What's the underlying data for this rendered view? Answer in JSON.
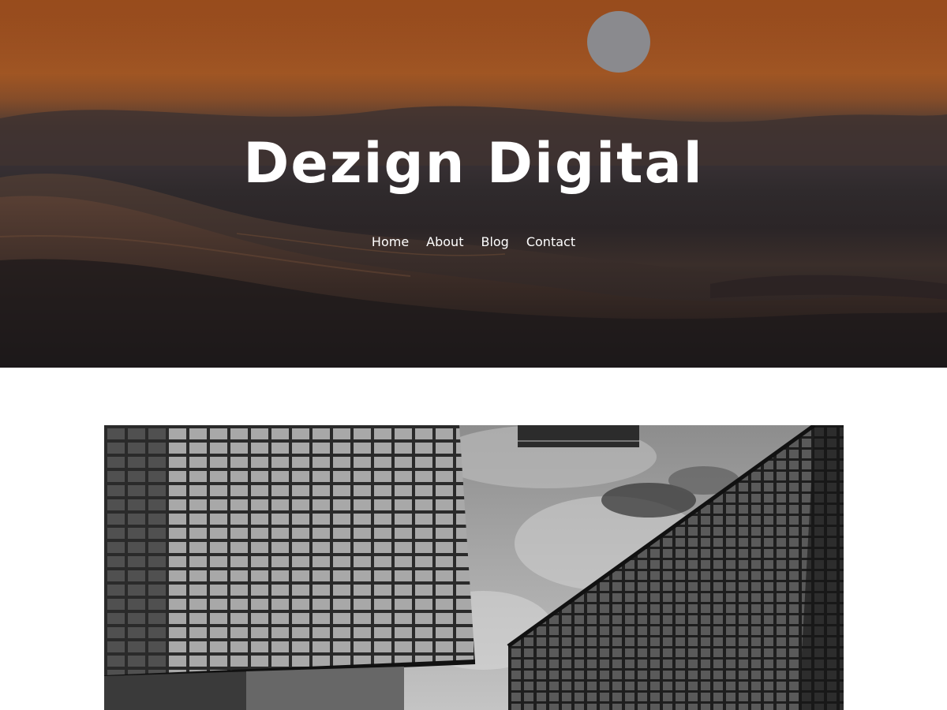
{
  "site": {
    "title": "Dezign Digital"
  },
  "nav": {
    "items": [
      {
        "label": "Home"
      },
      {
        "label": "About"
      },
      {
        "label": "Blog"
      },
      {
        "label": "Contact"
      }
    ]
  },
  "hero": {
    "image": "ocean-wave-sunset-photo"
  },
  "featured": {
    "image": "skyscrapers-looking-up-black-and-white-photo"
  }
}
